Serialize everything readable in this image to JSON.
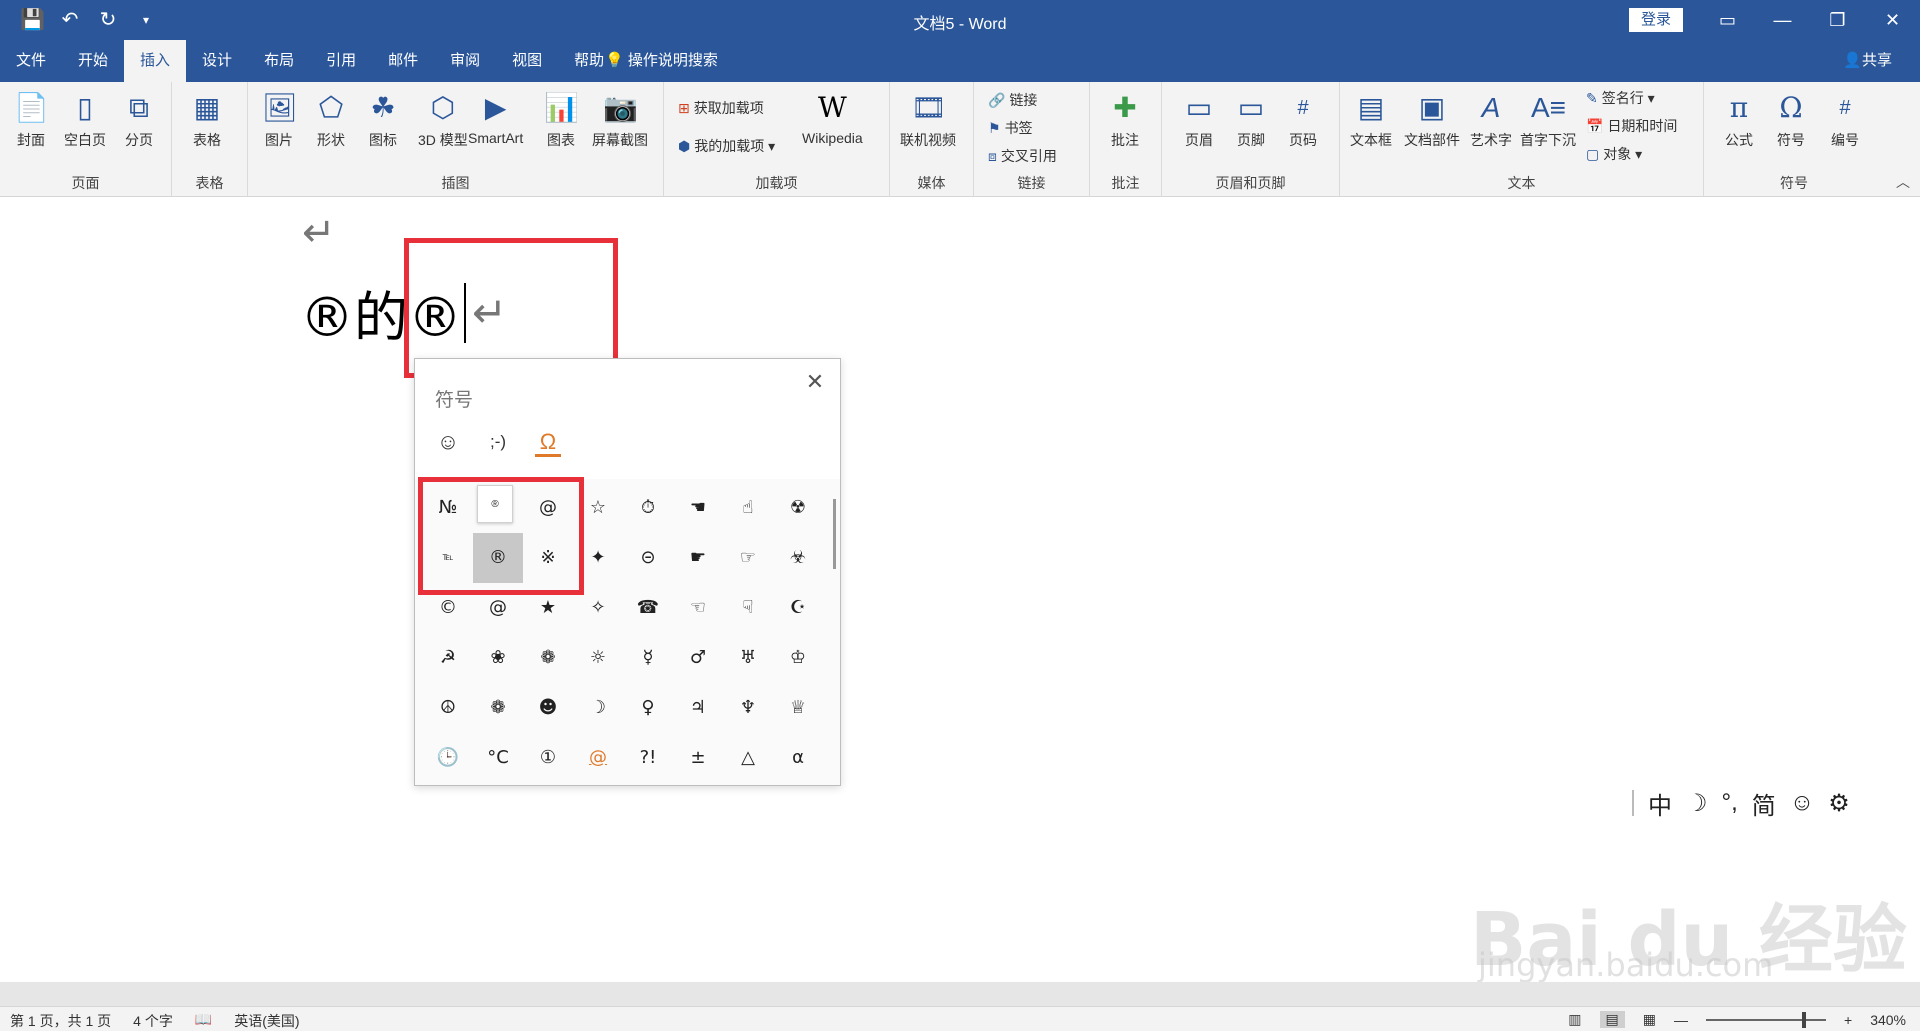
{
  "window": {
    "title": "文档5 - Word",
    "login": "登录",
    "quick_access": [
      "save-icon",
      "undo-icon",
      "redo-icon",
      "customize-icon"
    ],
    "controls": [
      "ribbon-display-icon",
      "minimize-icon",
      "maximize-icon",
      "close-icon"
    ]
  },
  "tabs": [
    "文件",
    "开始",
    "插入",
    "设计",
    "布局",
    "引用",
    "邮件",
    "审阅",
    "视图",
    "帮助"
  ],
  "active_tab": "插入",
  "tell_me": "操作说明搜索",
  "share": "共享",
  "ribbon": {
    "pages": {
      "label": "页面",
      "buttons": [
        "封面",
        "空白页",
        "分页"
      ]
    },
    "tables": {
      "label": "表格",
      "buttons": [
        "表格"
      ]
    },
    "illustrations": {
      "label": "插图",
      "buttons": [
        "图片",
        "形状",
        "图标",
        "3D 模型",
        "SmartArt",
        "图表",
        "屏幕截图"
      ]
    },
    "addins": {
      "label": "加载项",
      "get": "获取加载项",
      "my": "我的加载项",
      "wiki": "Wikipedia"
    },
    "media": {
      "label": "媒体",
      "buttons": [
        "联机视频"
      ]
    },
    "links": {
      "label": "链接",
      "items": [
        "链接",
        "书签",
        "交叉引用"
      ]
    },
    "comments": {
      "label": "批注",
      "buttons": [
        "批注"
      ]
    },
    "header_footer": {
      "label": "页眉和页脚",
      "buttons": [
        "页眉",
        "页脚",
        "页码"
      ]
    },
    "text": {
      "label": "文本",
      "buttons": [
        "文本框",
        "文档部件",
        "艺术字",
        "首字下沉"
      ],
      "small": [
        "签名行",
        "日期和时间",
        "对象"
      ]
    },
    "symbols": {
      "label": "符号",
      "buttons": [
        "公式",
        "符号",
        "编号"
      ]
    }
  },
  "document": {
    "paragraph_mark": "↵",
    "line_text": "®的®"
  },
  "symbol_panel": {
    "title": "符号",
    "categories": [
      "☺",
      ";-)",
      "Ω"
    ],
    "hover_preview": "®",
    "symbols": [
      "№",
      "®",
      "@",
      "☆",
      "⏱",
      "☚",
      "☝",
      "☢",
      "℡",
      "®",
      "※",
      "✦",
      "⊝",
      "☛",
      "☞",
      "☣",
      "©",
      "@",
      "★",
      "✧",
      "☎",
      "☜",
      "☟",
      "☪",
      "☭",
      "❀",
      "❁",
      "☼",
      "☿",
      "♂",
      "♅",
      "♔",
      "☮",
      "❁",
      "☻",
      "☽",
      "♀",
      "♃",
      "♆",
      "♕",
      "🕒",
      "°C",
      "①",
      "@",
      "?!",
      "±",
      "△",
      "α"
    ]
  },
  "ime": {
    "items": [
      "中",
      "☽",
      "°,",
      "简",
      "☺",
      "⚙"
    ]
  },
  "watermark": {
    "brand": "Bai du 经验",
    "url": "jingyan.baidu.com"
  },
  "status": {
    "page": "第 1 页，共 1 页",
    "words": "4 个字",
    "language": "英语(美国)",
    "zoom": "340%"
  }
}
